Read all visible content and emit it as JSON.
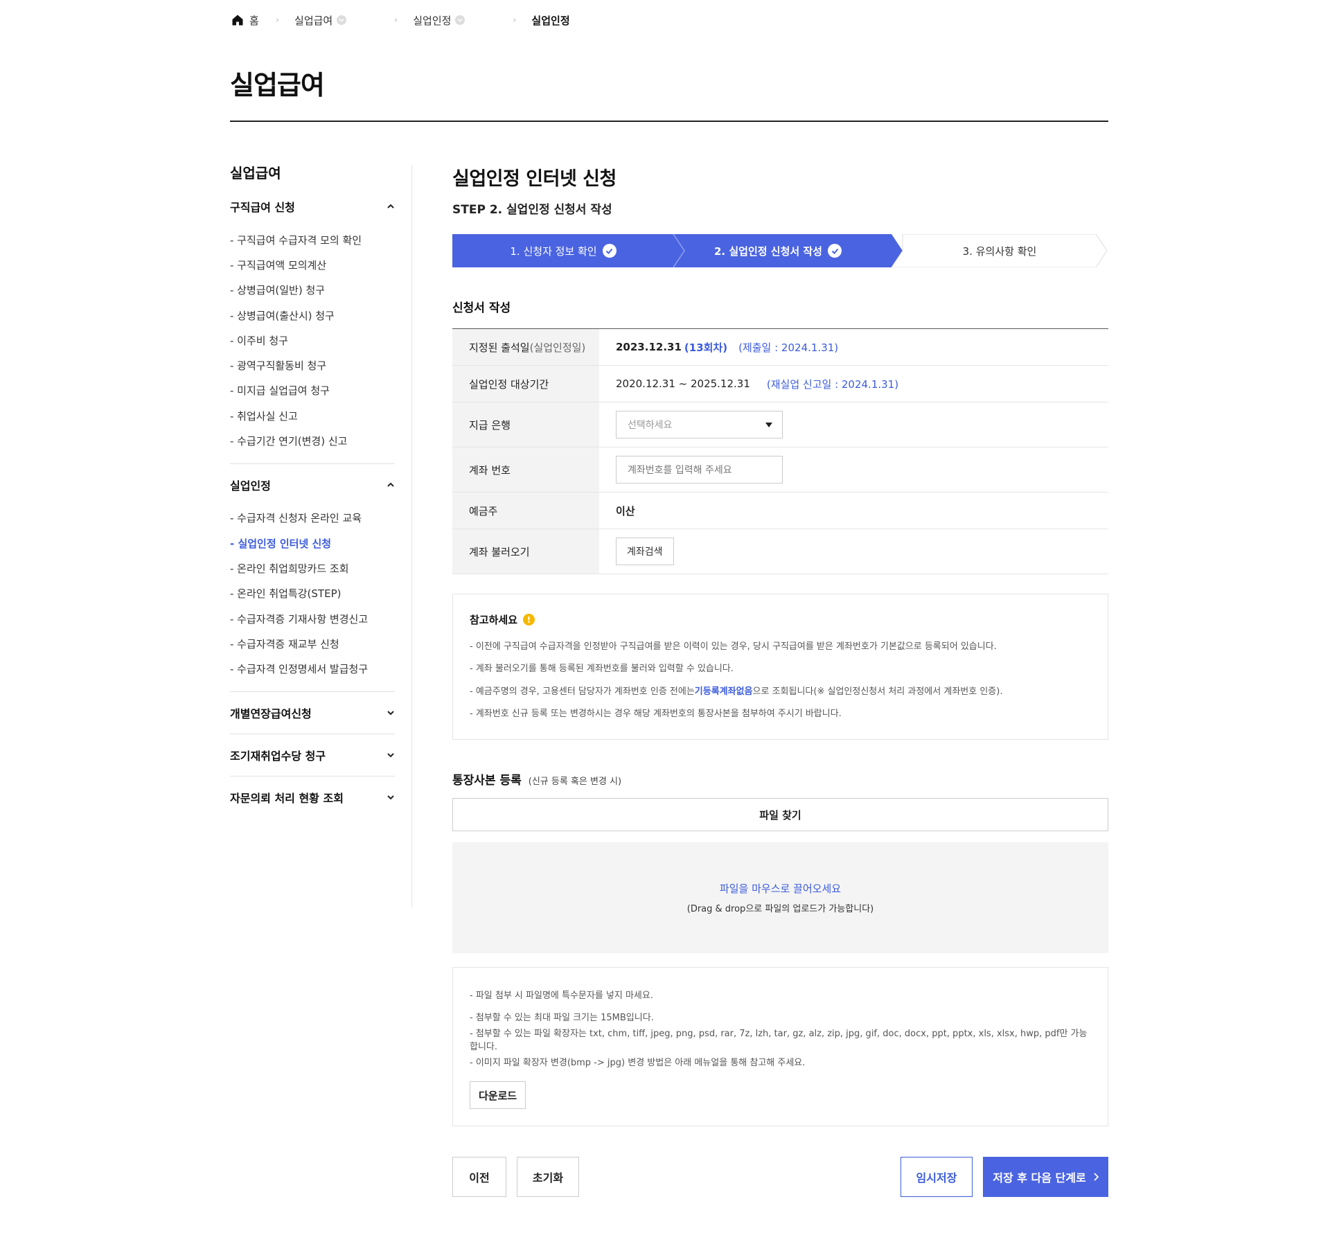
{
  "breadcrumb": {
    "home": "홈",
    "items": [
      "실업급여",
      "실업인정"
    ],
    "current": "실업인정"
  },
  "page_title": "실업급여",
  "sidebar": {
    "heading": "실업급여",
    "groups": [
      {
        "title": "구직급여 신청",
        "expanded": true,
        "items": [
          "- 구직급여 수급자격 모의 확인",
          "- 구직급여액 모의계산",
          "- 상병급여(일반) 청구",
          "- 상병급여(출산시) 청구",
          "- 이주비 청구",
          "- 광역구직활동비 청구",
          "- 미지급 실업급여 청구",
          "- 취업사실 신고",
          "- 수급기간 연기(변경) 신고"
        ]
      },
      {
        "title": "실업인정",
        "expanded": true,
        "items": [
          "- 수급자격 신청자 온라인 교육",
          "- 실업인정 인터넷 신청",
          "- 온라인 취업희망카드 조회",
          "- 온라인 취업특강(STEP)",
          "- 수급자격증 기재사항 변경신고",
          "- 수급자격증 재교부 신청",
          "- 수급자격 인정명세서 발급청구"
        ],
        "active_index": 1
      },
      {
        "title": "개별연장급여신청",
        "expanded": false
      },
      {
        "title": "조기재취업수당 청구",
        "expanded": false
      },
      {
        "title": "자문의뢰 처리 현황 조회",
        "expanded": false
      }
    ]
  },
  "main": {
    "title": "실업인정 인터넷 신청",
    "step_title": "STEP 2. 실업인정 신청서 작성",
    "steps": [
      "1. 신청자 정보 확인",
      "2. 실업인정 신청서 작성",
      "3. 유의사항 확인"
    ],
    "section_title": "신청서 작성",
    "form": {
      "attend_label": "지정된 출석일",
      "attend_label_sub": "(실업인정일)",
      "attend_date": "2023.12.31",
      "attend_round": "(13회차)",
      "attend_submit": "(제출일 : 2024.1.31)",
      "period_label": "실업인정 대상기간",
      "period_value": "2020.12.31 ~ 2025.12.31",
      "period_report": "(재실업 신고일 : 2024.1.31)",
      "bank_label": "지급 은행",
      "bank_placeholder": "선택하세요",
      "account_label": "계좌 번호",
      "account_placeholder": "계좌번호를 입력해 주세요",
      "holder_label": "예금주",
      "holder_value": "이산",
      "load_label": "계좌 불러오기",
      "load_button": "계좌검색"
    },
    "notice": {
      "title": "참고하세요",
      "items": [
        "- 이전에 구직급여 수급자격을 인정받아 구직급여를 받은 이력이 있는 경우, 당시 구직급여를 받은 계좌번호가 기본값으로 등록되어 있습니다.",
        "- 계좌 불러오기를 통해 등록된 계좌번호를 불러와 입력할 수 있습니다."
      ],
      "item3_pre": "- 예금주명의 경우, 고용센터 담당자가 계좌번호 인증 전에는 ",
      "item3_hl": "기등록계좌없음",
      "item3_post": "으로 조회됩니다(※ 실업인정신청서 처리 과정에서 계좌번호 인증).",
      "item4": "- 계좌번호 신규 등록 또는 변경하시는 경우 해당 계좌번호의 통장사본을 첨부하여 주시기 바랍니다."
    },
    "upload": {
      "title": "통장사본 등록",
      "subtitle": "(신규 등록 혹은 변경 시)",
      "file_button": "파일 찾기",
      "drop_main": "파일을 마우스로 끌어오세요",
      "drop_sub": "(Drag & drop으로 파일의 업로드가 가능합니다)",
      "notes": [
        "- 파일 첨부 시 파일명에 특수문자를 넣지 마세요.",
        "- 첨부할 수 있는 최대 파일 크기는 15MB입니다.",
        "- 첨부할 수 있는 파일 확장자는 txt, chm, tiff, jpeg, png, psd, rar, 7z, lzh, tar, gz, alz, zip, jpg, gif, doc, docx, ppt, pptx, xls, xlsx, hwp, pdf만 가능합니다.",
        "- 이미지 파일 확장자 변경(bmp -> jpg) 변경 방법은 아래 메뉴얼을 통해 참고해 주세요."
      ],
      "download_button": "다운로드"
    },
    "buttons": {
      "prev": "이전",
      "reset": "초기화",
      "temp_save": "임시저장",
      "next": "저장 후 다음 단계로"
    }
  },
  "colors": {
    "accent": "#4a63e0",
    "link": "#3b5bdb",
    "warn": "#f5b800"
  }
}
